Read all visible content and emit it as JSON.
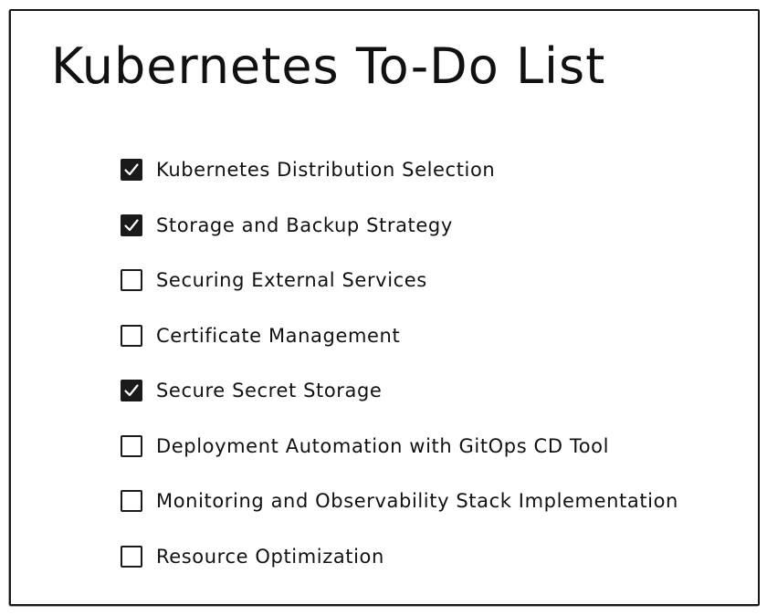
{
  "title": "Kubernetes To-Do List",
  "items": [
    {
      "label": "Kubernetes Distribution Selection",
      "checked": true
    },
    {
      "label": "Storage and Backup Strategy",
      "checked": true
    },
    {
      "label": "Securing External Services",
      "checked": false
    },
    {
      "label": "Certificate Management",
      "checked": false
    },
    {
      "label": "Secure Secret Storage",
      "checked": true
    },
    {
      "label": "Deployment Automation with GitOps CD Tool",
      "checked": false
    },
    {
      "label": "Monitoring and Observability Stack Implementation",
      "checked": false
    },
    {
      "label": "Resource Optimization",
      "checked": false
    }
  ],
  "colors": {
    "ink": "#1a1a1a",
    "background": "#ffffff"
  }
}
